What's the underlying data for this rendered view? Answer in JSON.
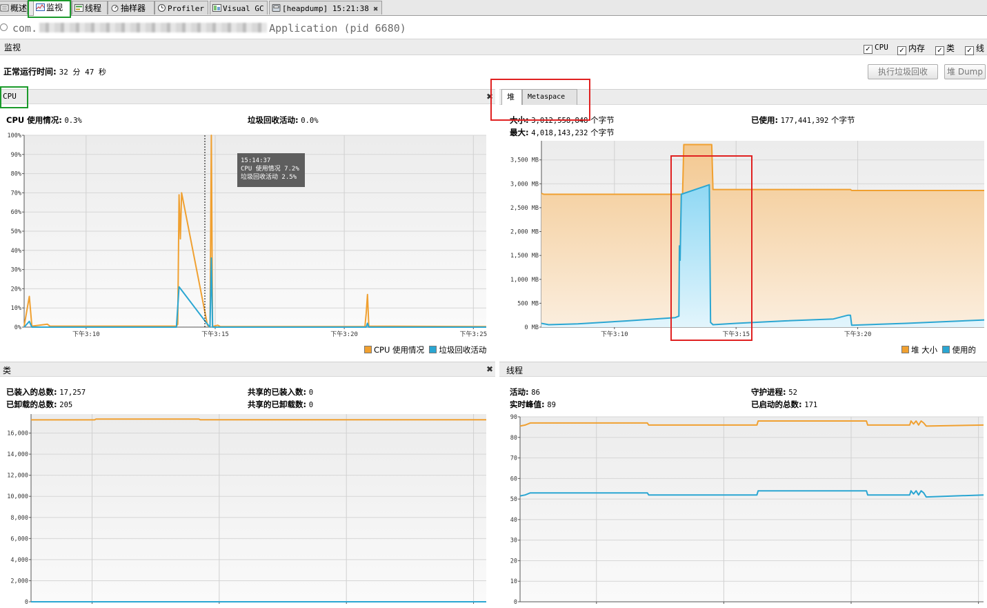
{
  "tabs": [
    {
      "label": "概述",
      "icon": "overview-icon"
    },
    {
      "label": "监视",
      "icon": "monitor-icon"
    },
    {
      "label": "线程",
      "icon": "threads-icon"
    },
    {
      "label": "抽样器",
      "icon": "sampler-icon"
    },
    {
      "label": "Profiler",
      "icon": "profiler-icon"
    },
    {
      "label": "Visual GC",
      "icon": "visual-gc-icon"
    },
    {
      "label": "[heapdump] 15:21:38",
      "icon": "heapdump-icon"
    }
  ],
  "app": {
    "prefix": "com.",
    "name": "Application",
    "pid": "(pid 6680)"
  },
  "monitor": {
    "title": "监视",
    "checkboxes": [
      "CPU",
      "内存",
      "类",
      "线"
    ],
    "uptime_label": "正常运行时间:",
    "uptime_value": "32 分 47 秒",
    "gc_button": "执行垃圾回收",
    "dump_button": "堆 Dump"
  },
  "cpu_panel": {
    "title": "CPU",
    "usage_label": "CPU 使用情况:",
    "usage_value": "0.3%",
    "gc_label": "垃圾回收活动:",
    "gc_value": "0.0%",
    "tooltip": {
      "time": "15:14:37",
      "line1": "CPU 使用情况  7.2%",
      "line2": "垃圾回收活动  2.5%"
    },
    "legend": [
      "CPU 使用情况",
      "垃圾回收活动"
    ]
  },
  "heap_panel": {
    "tabs": [
      "堆",
      "Metaspace"
    ],
    "size_label": "大小:",
    "size_value": "3,012,558,848",
    "max_label": "最大:",
    "max_value": "4,018,143,232",
    "used_label": "已使用:",
    "used_value": "177,441,392",
    "unit": "个字节",
    "legend": [
      "堆 大小",
      "使用的"
    ]
  },
  "classes_panel": {
    "title": "类",
    "loaded_label": "已装入的总数:",
    "loaded_value": "17,257",
    "unloaded_label": "已卸载的总数:",
    "unloaded_value": "205",
    "shared_loaded_label": "共享的已装入数:",
    "shared_loaded_value": "0",
    "shared_unloaded_label": "共享的已卸载数:",
    "shared_unloaded_value": "0"
  },
  "threads_panel": {
    "title": "线程",
    "live_label": "活动:",
    "live_value": "86",
    "peak_label": "实时峰值:",
    "peak_value": "89",
    "daemon_label": "守护进程:",
    "daemon_value": "52",
    "started_label": "已启动的总数:",
    "started_value": "171"
  },
  "colors": {
    "orange": "#f0a030",
    "blue": "#2aa6d2",
    "highlight_red": "#e02020",
    "highlight_green": "#1a9a2a"
  },
  "chart_data": [
    {
      "type": "line",
      "name": "cpu",
      "ylim": [
        0,
        100
      ],
      "yticks": [
        "0%",
        "10%",
        "20%",
        "30%",
        "40%",
        "50%",
        "60%",
        "70%",
        "80%",
        "90%",
        "100%"
      ],
      "xticks": [
        {
          "label": "下午3:10",
          "t": 10
        },
        {
          "label": "下午3:15",
          "t": 15
        },
        {
          "label": "下午3:20",
          "t": 20
        },
        {
          "label": "下午3:25",
          "t": 25
        }
      ],
      "xlim": [
        7.6,
        25.5
      ],
      "series": [
        {
          "name": "CPU 使用情况",
          "color": "#f0a030",
          "points": [
            [
              7.6,
              0.5
            ],
            [
              7.8,
              16
            ],
            [
              7.9,
              0.5
            ],
            [
              8.5,
              1.5
            ],
            [
              8.6,
              0.5
            ],
            [
              13.5,
              0.5
            ],
            [
              13.55,
              1.5
            ],
            [
              13.6,
              69
            ],
            [
              13.65,
              46
            ],
            [
              13.7,
              70
            ],
            [
              14.7,
              1
            ],
            [
              14.8,
              0
            ],
            [
              14.85,
              100
            ],
            [
              14.9,
              0.3
            ],
            [
              15.1,
              1
            ],
            [
              15.2,
              0.3
            ],
            [
              20.8,
              0.3
            ],
            [
              20.85,
              7
            ],
            [
              20.9,
              17
            ],
            [
              20.95,
              0.5
            ],
            [
              25.5,
              0.3
            ]
          ]
        },
        {
          "name": "垃圾回收活动",
          "color": "#2aa6d2",
          "points": [
            [
              7.6,
              0
            ],
            [
              7.8,
              3
            ],
            [
              7.9,
              0
            ],
            [
              13.5,
              0
            ],
            [
              13.6,
              21
            ],
            [
              14.7,
              1.5
            ],
            [
              14.8,
              0
            ],
            [
              14.85,
              36
            ],
            [
              14.9,
              0
            ],
            [
              20.85,
              0
            ],
            [
              20.9,
              2
            ],
            [
              20.95,
              0
            ],
            [
              25.5,
              0
            ]
          ]
        }
      ]
    },
    {
      "type": "area",
      "name": "heap",
      "unit": "MB",
      "ylim": [
        0,
        3900
      ],
      "yticks": [
        "0 MB",
        "500 MB",
        "1,000 MB",
        "1,500 MB",
        "2,000 MB",
        "2,500 MB",
        "3,000 MB",
        "3,500 MB"
      ],
      "xticks": [
        {
          "label": "下午3:10",
          "t": 10
        },
        {
          "label": "下午3:15",
          "t": 15
        },
        {
          "label": "下午3:20",
          "t": 20
        }
      ],
      "xlim": [
        7.0,
        25.2
      ],
      "series": [
        {
          "name": "堆 大小",
          "color": "#f0a030",
          "points": [
            [
              7.0,
              2800
            ],
            [
              7.1,
              2780
            ],
            [
              12.8,
              2780
            ],
            [
              12.85,
              3820
            ],
            [
              14.0,
              3820
            ],
            [
              14.05,
              2880
            ],
            [
              19.7,
              2880
            ],
            [
              19.75,
              2860
            ],
            [
              25.2,
              2860
            ]
          ]
        },
        {
          "name": "使用的",
          "color": "#2aa6d2",
          "points": [
            [
              7.0,
              80
            ],
            [
              7.3,
              50
            ],
            [
              8.5,
              70
            ],
            [
              10.5,
              130
            ],
            [
              12.5,
              200
            ],
            [
              12.65,
              230
            ],
            [
              12.67,
              1700
            ],
            [
              12.7,
              1400
            ],
            [
              12.72,
              2000
            ],
            [
              12.75,
              2780
            ],
            [
              13.9,
              2980
            ],
            [
              13.95,
              100
            ],
            [
              14.05,
              50
            ],
            [
              15,
              80
            ],
            [
              17,
              130
            ],
            [
              19.0,
              170
            ],
            [
              19.6,
              250
            ],
            [
              19.7,
              250
            ],
            [
              19.75,
              40
            ],
            [
              22,
              80
            ],
            [
              25.2,
              150
            ]
          ]
        }
      ]
    },
    {
      "type": "line",
      "name": "classes",
      "ylim": [
        0,
        17800
      ],
      "yticks": [
        "0",
        "2,000",
        "4,000",
        "6,000",
        "8,000",
        "10,000",
        "12,000",
        "14,000",
        "16,000"
      ],
      "xlim": [
        7.6,
        25.5
      ],
      "xticks_t": [
        10,
        15,
        20,
        25
      ],
      "series": [
        {
          "name": "已装入的总数",
          "color": "#f0a030",
          "points": [
            [
              7.6,
              17250
            ],
            [
              10.1,
              17250
            ],
            [
              10.15,
              17320
            ],
            [
              14.2,
              17320
            ],
            [
              14.25,
              17257
            ],
            [
              25.5,
              17257
            ]
          ]
        },
        {
          "name": "共享的已装入数",
          "color": "#2aa6d2",
          "points": [
            [
              7.6,
              0
            ],
            [
              25.5,
              0
            ]
          ]
        }
      ]
    },
    {
      "type": "line",
      "name": "threads",
      "ylim": [
        0,
        90
      ],
      "yticks": [
        "0",
        "10",
        "20",
        "30",
        "40",
        "50",
        "60",
        "70",
        "80",
        "90"
      ],
      "xlim": [
        7.0,
        25.2
      ],
      "xticks_t": [
        10,
        15,
        20,
        25
      ],
      "series": [
        {
          "name": "活动",
          "color": "#f0a030",
          "points": [
            [
              7.0,
              85.5
            ],
            [
              7.2,
              86
            ],
            [
              7.4,
              87
            ],
            [
              12.0,
              87
            ],
            [
              12.05,
              86
            ],
            [
              16.3,
              86
            ],
            [
              16.35,
              88
            ],
            [
              20.6,
              88
            ],
            [
              20.65,
              86
            ],
            [
              22.3,
              86
            ],
            [
              22.35,
              88
            ],
            [
              22.45,
              86.5
            ],
            [
              22.55,
              88
            ],
            [
              22.65,
              86
            ],
            [
              22.75,
              88
            ],
            [
              22.85,
              87
            ],
            [
              22.95,
              85.5
            ],
            [
              25.2,
              86
            ]
          ]
        },
        {
          "name": "守护进程",
          "color": "#2aa6d2",
          "points": [
            [
              7.0,
              51.5
            ],
            [
              7.2,
              52
            ],
            [
              7.4,
              53
            ],
            [
              12.0,
              53
            ],
            [
              12.05,
              52
            ],
            [
              16.3,
              52
            ],
            [
              16.35,
              54
            ],
            [
              20.6,
              54
            ],
            [
              20.65,
              52
            ],
            [
              22.3,
              52
            ],
            [
              22.35,
              54
            ],
            [
              22.45,
              52.5
            ],
            [
              22.55,
              54
            ],
            [
              22.65,
              52
            ],
            [
              22.75,
              54
            ],
            [
              22.85,
              53
            ],
            [
              22.95,
              51
            ],
            [
              25.2,
              52
            ]
          ]
        }
      ]
    }
  ]
}
